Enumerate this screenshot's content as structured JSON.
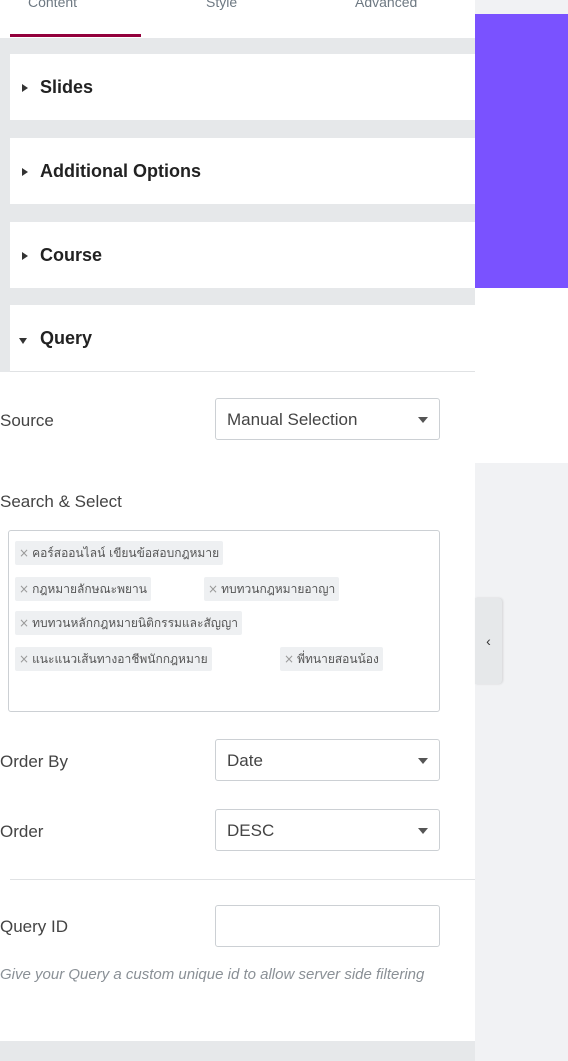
{
  "tabs": [
    {
      "label": "Content"
    },
    {
      "label": "Style"
    },
    {
      "label": "Advanced"
    }
  ],
  "sections": {
    "slides": {
      "title": "Slides"
    },
    "additional_options": {
      "title": "Additional Options"
    },
    "course": {
      "title": "Course"
    },
    "query": {
      "title": "Query"
    }
  },
  "query": {
    "source": {
      "label": "Source",
      "value": "Manual Selection"
    },
    "search": {
      "label": "Search & Select",
      "selected": [
        "คอร์สออนไลน์ เขียนข้อสอบกฎหมาย",
        "กฎหมายลักษณะพยาน",
        "ทบทวนกฎหมายอาญา",
        "ทบทวนหลักกฎหมายนิติกรรมและสัญญา",
        "แนะแนวเส้นทางอาชีพนักกฎหมาย",
        "พี่ทนายสอนน้อง"
      ]
    },
    "order_by": {
      "label": "Order By",
      "value": "Date"
    },
    "order": {
      "label": "Order",
      "value": "DESC"
    },
    "query_id": {
      "label": "Query ID",
      "value": "",
      "help": "Give your Query a custom unique id to allow server side filtering"
    }
  },
  "icons": {
    "collapse": "chevron-left-icon",
    "section_collapsed": "caret-right-icon",
    "section_expanded": "caret-down-icon",
    "select_caret": "caret-down-icon",
    "chip_remove": "close-icon"
  },
  "colors": {
    "accent": "#93003c",
    "preview_purple": "#7a52ff",
    "panel_bg": "#e6e8ea"
  }
}
